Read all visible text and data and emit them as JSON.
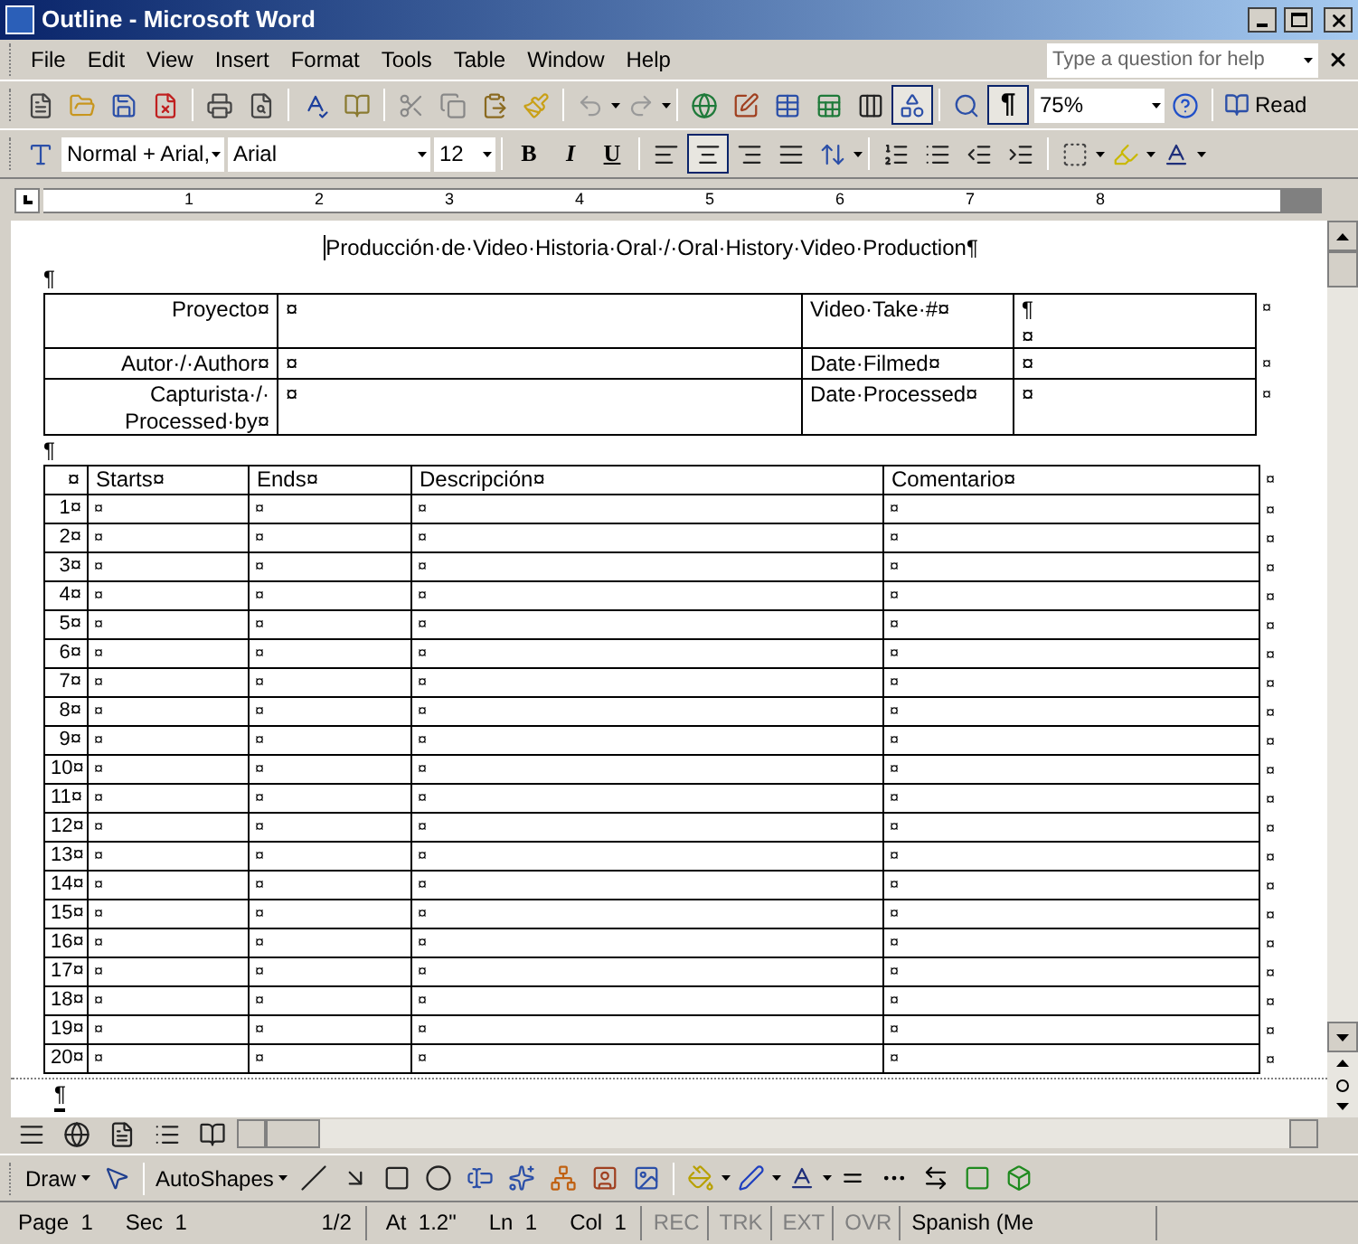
{
  "window": {
    "title": "Outline - Microsoft Word"
  },
  "menu": [
    "File",
    "Edit",
    "View",
    "Insert",
    "Format",
    "Tools",
    "Table",
    "Window",
    "Help"
  ],
  "help_box": {
    "placeholder": "Type a question for help"
  },
  "standard_toolbar": {
    "drawing_pressed": true,
    "show_marks": {
      "label": "¶",
      "pressed": true
    },
    "zoom": "75%",
    "read": "Read"
  },
  "formatting_toolbar": {
    "style": "Normal + Arial,",
    "font": "Arial",
    "size": "12",
    "format_buttons": [
      {
        "label": "B",
        "pressed": false
      },
      {
        "label": "I",
        "pressed": false
      },
      {
        "label": "U",
        "pressed": false
      }
    ],
    "alignment": [
      {
        "selected": false
      },
      {
        "selected": true
      },
      {
        "selected": false
      },
      {
        "selected": false
      }
    ]
  },
  "ruler": [
    "1",
    "2",
    "3",
    "4",
    "5",
    "6",
    "7",
    "8"
  ],
  "document": {
    "title": "Producción·de·Video·Historia·Oral·/·Oral·History·Video·Production¶",
    "mark_after_title": "¶",
    "mark_between_tables": "¶",
    "mark_end": "¶",
    "info_table": [
      {
        "cells": [
          "Proyecto¤",
          "¤",
          "Video·Take·#¤",
          "¶\n¤"
        ],
        "end_mark": "¤"
      },
      {
        "cells": [
          "Autor·/·Author¤",
          "¤",
          "Date·Filmed¤",
          "¤"
        ],
        "end_mark": "¤"
      },
      {
        "cells": [
          "Capturista·/·\nProcessed·by¤",
          "¤",
          "Date·Processed¤",
          "¤"
        ],
        "end_mark": "¤"
      }
    ],
    "log_table": {
      "columns": [
        "¤",
        "Starts¤",
        "Ends¤",
        "Descripción¤",
        "Comentario¤"
      ],
      "header_end_mark": "¤",
      "rows": [
        {
          "cells": [
            "1¤",
            "¤",
            "¤",
            "¤",
            "¤"
          ],
          "end_mark": "¤"
        },
        {
          "cells": [
            "2¤",
            "¤",
            "¤",
            "¤",
            "¤"
          ],
          "end_mark": "¤"
        },
        {
          "cells": [
            "3¤",
            "¤",
            "¤",
            "¤",
            "¤"
          ],
          "end_mark": "¤"
        },
        {
          "cells": [
            "4¤",
            "¤",
            "¤",
            "¤",
            "¤"
          ],
          "end_mark": "¤"
        },
        {
          "cells": [
            "5¤",
            "¤",
            "¤",
            "¤",
            "¤"
          ],
          "end_mark": "¤"
        },
        {
          "cells": [
            "6¤",
            "¤",
            "¤",
            "¤",
            "¤"
          ],
          "end_mark": "¤"
        },
        {
          "cells": [
            "7¤",
            "¤",
            "¤",
            "¤",
            "¤"
          ],
          "end_mark": "¤"
        },
        {
          "cells": [
            "8¤",
            "¤",
            "¤",
            "¤",
            "¤"
          ],
          "end_mark": "¤"
        },
        {
          "cells": [
            "9¤",
            "¤",
            "¤",
            "¤",
            "¤"
          ],
          "end_mark": "¤"
        },
        {
          "cells": [
            "10¤",
            "¤",
            "¤",
            "¤",
            "¤"
          ],
          "end_mark": "¤"
        },
        {
          "cells": [
            "11¤",
            "¤",
            "¤",
            "¤",
            "¤"
          ],
          "end_mark": "¤"
        },
        {
          "cells": [
            "12¤",
            "¤",
            "¤",
            "¤",
            "¤"
          ],
          "end_mark": "¤"
        },
        {
          "cells": [
            "13¤",
            "¤",
            "¤",
            "¤",
            "¤"
          ],
          "end_mark": "¤"
        },
        {
          "cells": [
            "14¤",
            "¤",
            "¤",
            "¤",
            "¤"
          ],
          "end_mark": "¤"
        },
        {
          "cells": [
            "15¤",
            "¤",
            "¤",
            "¤",
            "¤"
          ],
          "end_mark": "¤"
        },
        {
          "cells": [
            "16¤",
            "¤",
            "¤",
            "¤",
            "¤"
          ],
          "end_mark": "¤"
        },
        {
          "cells": [
            "17¤",
            "¤",
            "¤",
            "¤",
            "¤"
          ],
          "end_mark": "¤"
        },
        {
          "cells": [
            "18¤",
            "¤",
            "¤",
            "¤",
            "¤"
          ],
          "end_mark": "¤"
        },
        {
          "cells": [
            "19¤",
            "¤",
            "¤",
            "¤",
            "¤"
          ],
          "end_mark": "¤"
        },
        {
          "cells": [
            "20¤",
            "¤",
            "¤",
            "¤",
            "¤"
          ],
          "end_mark": "¤"
        }
      ]
    }
  },
  "drawing_toolbar": {
    "draw": "Draw",
    "autoshapes": "AutoShapes"
  },
  "status_bar": {
    "fields": [
      "Page  1",
      "Sec  1",
      "1/2",
      "At  1.2\"",
      "Ln  1",
      "Col  1"
    ],
    "modes": [
      {
        "label": "REC",
        "active": false
      },
      {
        "label": "TRK",
        "active": false
      },
      {
        "label": "EXT",
        "active": false
      },
      {
        "label": "OVR",
        "active": false
      }
    ],
    "language": "Spanish (Me"
  }
}
